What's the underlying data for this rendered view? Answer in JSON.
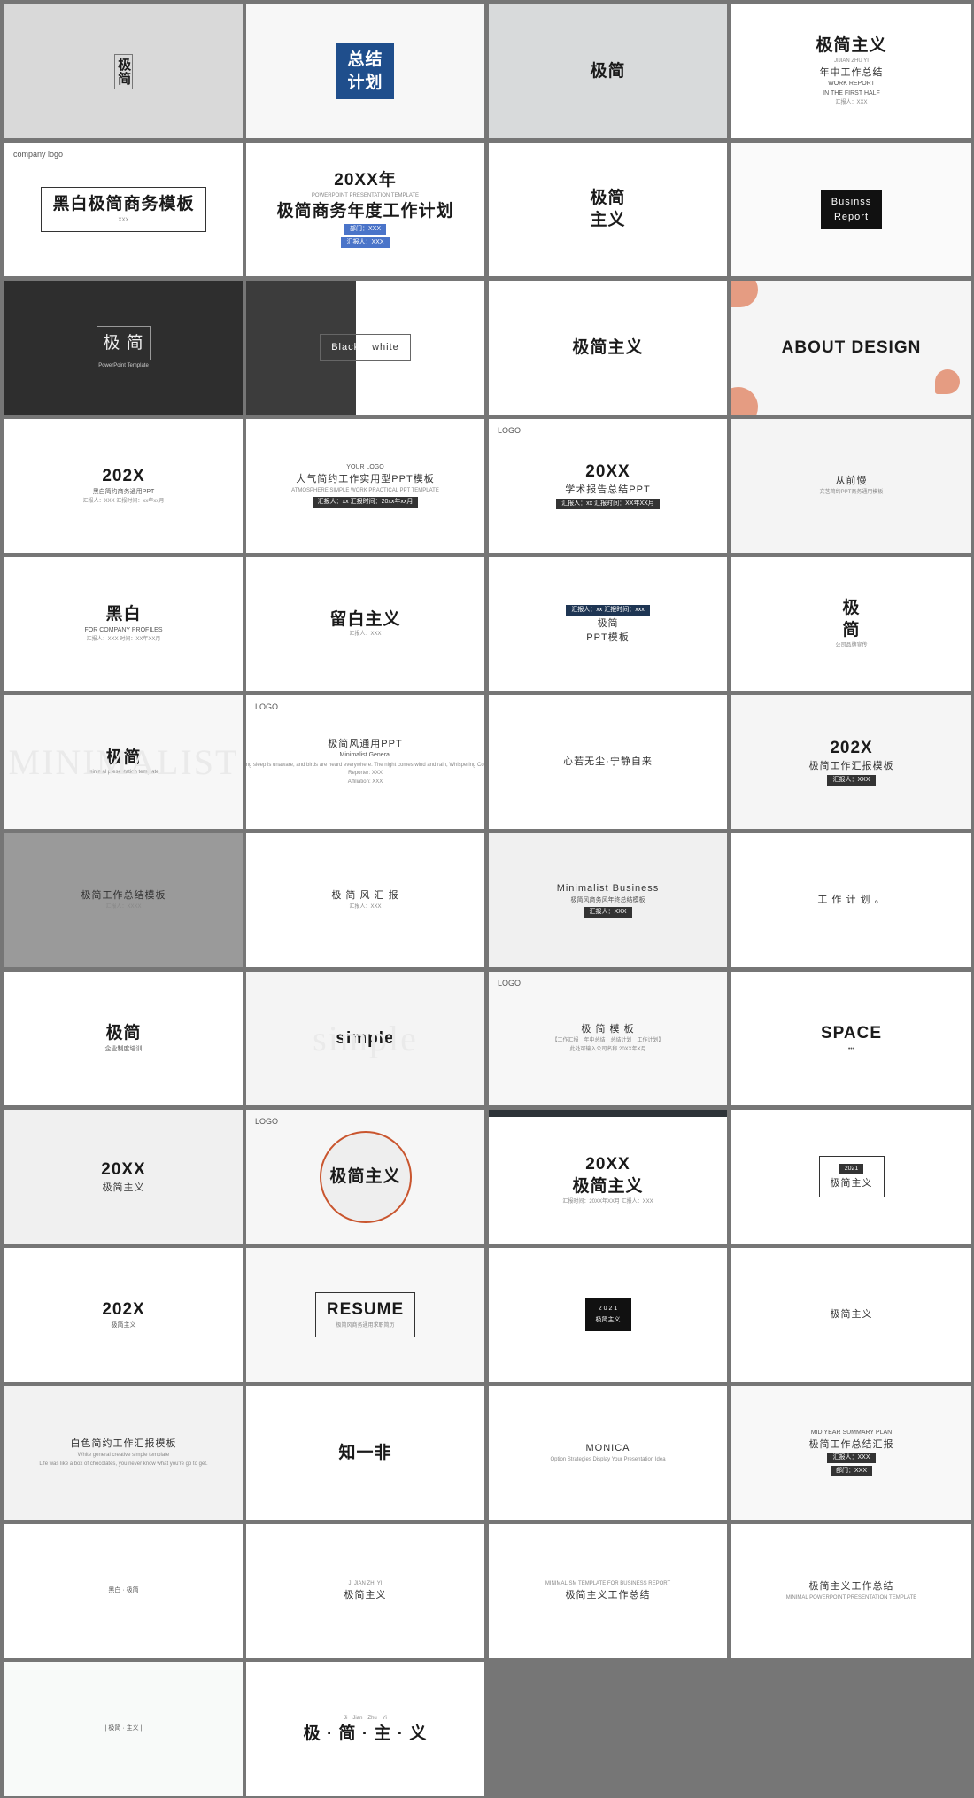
{
  "background_color": "#767676",
  "tiles": [
    {
      "bg": "#d9d9d9",
      "lines": [
        {
          "role": "title",
          "text": "极简"
        }
      ]
    },
    {
      "bg": "#f7f7f7",
      "accent": "#1f4e8c",
      "lines": [
        {
          "role": "title",
          "text": "总结"
        },
        {
          "role": "title",
          "text": "计划"
        }
      ]
    },
    {
      "bg": "#d8dadb",
      "lines": [
        {
          "role": "title",
          "text": "极简"
        }
      ]
    },
    {
      "bg": "#ffffff",
      "lines": [
        {
          "role": "title",
          "text": "极简主义"
        },
        {
          "role": "caption",
          "text": "JIJIAN ZHU YI"
        },
        {
          "role": "subtitle",
          "text": "年中工作总结"
        },
        {
          "role": "label",
          "text": "WORK REPORT"
        },
        {
          "role": "label",
          "text": "IN THE FIRST HALF"
        },
        {
          "role": "caption",
          "text": "汇报人：XXX"
        }
      ]
    },
    {
      "bg": "#ffffff",
      "lines": [
        {
          "role": "logo",
          "text": "company logo"
        },
        {
          "role": "title",
          "text": "黑白极简商务模板"
        },
        {
          "role": "caption",
          "text": "XXX"
        }
      ]
    },
    {
      "bg": "#ffffff",
      "accent": "#4a74c9",
      "lines": [
        {
          "role": "title",
          "text": "20XX年"
        },
        {
          "role": "caption",
          "text": "POWERPOINT PRESENTATION TEMPLATE"
        },
        {
          "role": "title",
          "text": "极简商务年度工作计划"
        },
        {
          "role": "badge",
          "text": "部门：XXX"
        },
        {
          "role": "badge",
          "text": "汇报人：XXX"
        }
      ]
    },
    {
      "bg": "#ffffff",
      "lines": [
        {
          "role": "title",
          "text": "极简"
        },
        {
          "role": "title",
          "text": "主义"
        }
      ]
    },
    {
      "bg": "#fafafa",
      "lines": [
        {
          "role": "subtitle",
          "text": "Businss"
        },
        {
          "role": "subtitle",
          "text": "Report"
        }
      ]
    },
    {
      "bg": "#2e2e2e",
      "lines": [
        {
          "role": "title",
          "text": "极 简"
        },
        {
          "role": "caption",
          "text": "PowerPoint Template"
        }
      ]
    },
    {
      "bg": "#ffffff",
      "lines": [
        {
          "role": "subtitle",
          "text": "Black"
        },
        {
          "role": "subtitle",
          "text": "white"
        }
      ]
    },
    {
      "bg": "#ffffff",
      "lines": [
        {
          "role": "title",
          "text": "极简主义"
        }
      ]
    },
    {
      "bg": "#f5f5f5",
      "accent": "#e59c82",
      "lines": [
        {
          "role": "title",
          "text": "ABOUT DESIGN"
        }
      ]
    },
    {
      "bg": "#ffffff",
      "lines": [
        {
          "role": "title",
          "text": "202X"
        },
        {
          "role": "label",
          "text": "黑白简约商务通用PPT"
        },
        {
          "role": "caption",
          "text": "汇报人：XXX 汇报时间：xx年xx月"
        }
      ]
    },
    {
      "bg": "#ffffff",
      "lines": [
        {
          "role": "label",
          "text": "YOUR LOGO"
        },
        {
          "role": "subtitle",
          "text": "大气简约工作实用型PPT模板"
        },
        {
          "role": "caption",
          "text": "ATMOSPHERE SIMPLE WORK PRACTICAL PPT TEMPLATE"
        },
        {
          "role": "badge",
          "text": "汇报人：xx 汇报时间：20xx年xx月"
        }
      ]
    },
    {
      "bg": "#ffffff",
      "lines": [
        {
          "role": "logo",
          "text": "LOGO"
        },
        {
          "role": "title",
          "text": "20XX"
        },
        {
          "role": "subtitle",
          "text": "学术报告总结PPT"
        },
        {
          "role": "badge",
          "text": "汇报人：xx 汇报时间：XX年XX月"
        }
      ]
    },
    {
      "bg": "#f4f4f4",
      "lines": [
        {
          "role": "subtitle",
          "text": "从前慢"
        },
        {
          "role": "caption",
          "text": "文艺简约PPT商务通用模板"
        }
      ]
    },
    {
      "bg": "#ffffff",
      "lines": [
        {
          "role": "title",
          "text": "黑白"
        },
        {
          "role": "label",
          "text": "FOR COMPANY PROFILES"
        },
        {
          "role": "caption",
          "text": "汇报人：XXX 时间：XX年XX月"
        }
      ]
    },
    {
      "bg": "#ffffff",
      "lines": [
        {
          "role": "title",
          "text": "留白主义"
        },
        {
          "role": "caption",
          "text": "汇报人：XXX"
        }
      ]
    },
    {
      "bg": "#ffffff",
      "accent": "#1e3553",
      "lines": [
        {
          "role": "badge",
          "text": "汇报人：xx 汇报时间：xxx"
        },
        {
          "role": "subtitle",
          "text": "极简"
        },
        {
          "role": "subtitle",
          "text": "PPT模板"
        }
      ]
    },
    {
      "bg": "#ffffff",
      "lines": [
        {
          "role": "title",
          "text": "极"
        },
        {
          "role": "title",
          "text": "简"
        },
        {
          "role": "caption",
          "text": "公司品牌宣传"
        }
      ]
    },
    {
      "bg": "#f7f7f7",
      "lines": [
        {
          "role": "watermark",
          "text": "MINIMALIST"
        },
        {
          "role": "title",
          "text": "极简"
        },
        {
          "role": "caption",
          "text": "minimal presentation template"
        }
      ]
    },
    {
      "bg": "#ffffff",
      "lines": [
        {
          "role": "logo",
          "text": "LOGO"
        },
        {
          "role": "subtitle",
          "text": "极简风通用PPT"
        },
        {
          "role": "label",
          "text": "Minimalist General"
        },
        {
          "role": "caption",
          "text": "Spring sleep is unaware, and birds are heard everywhere. The night comes wind and rain, Whispering Colour."
        },
        {
          "role": "caption",
          "text": "Reporter: XXX"
        },
        {
          "role": "caption",
          "text": "Affiliation: XXX"
        }
      ]
    },
    {
      "bg": "#ffffff",
      "accent": "#6a9a98",
      "lines": [
        {
          "role": "subtitle",
          "text": "心若无尘·宁静自来"
        }
      ]
    },
    {
      "bg": "#f5f5f5",
      "lines": [
        {
          "role": "title",
          "text": "202X"
        },
        {
          "role": "subtitle",
          "text": "极简工作汇报模板"
        },
        {
          "role": "badge",
          "text": "汇报人：XXX"
        }
      ]
    },
    {
      "bg": "#9a9a9a",
      "lines": [
        {
          "role": "subtitle",
          "text": "极简工作总结模板"
        },
        {
          "role": "caption",
          "text": "汇报人：XXXX"
        }
      ]
    },
    {
      "bg": "#ffffff",
      "lines": [
        {
          "role": "subtitle",
          "text": "极 简 风 汇 报"
        },
        {
          "role": "caption",
          "text": "汇报人：XXX"
        }
      ]
    },
    {
      "bg": "#f0f0f0",
      "lines": [
        {
          "role": "subtitle",
          "text": "Minimalist Business"
        },
        {
          "role": "label",
          "text": "极简风商务风年终总结模板"
        },
        {
          "role": "badge",
          "text": "汇报人：XXX"
        }
      ]
    },
    {
      "bg": "#ffffff",
      "lines": [
        {
          "role": "subtitle",
          "text": "工 作 计 划 。"
        }
      ]
    },
    {
      "bg": "#ffffff",
      "accent": "#3a3d4a",
      "lines": [
        {
          "role": "title",
          "text": "极简"
        },
        {
          "role": "label",
          "text": "企业制度培训"
        }
      ]
    },
    {
      "bg": "#f4f4f4",
      "lines": [
        {
          "role": "watermark",
          "text": "simple"
        },
        {
          "role": "title",
          "text": "simple"
        }
      ]
    },
    {
      "bg": "#f7f7f7",
      "lines": [
        {
          "role": "logo",
          "text": "LOGO"
        },
        {
          "role": "subtitle",
          "text": "极 简 模 板"
        },
        {
          "role": "caption",
          "text": "【工作汇报　年中总结　总结计划　工作计划】"
        },
        {
          "role": "caption",
          "text": "此处可输入公司名称 20XX年X月"
        }
      ]
    },
    {
      "bg": "#ffffff",
      "lines": [
        {
          "role": "title",
          "text": "SPACE"
        },
        {
          "role": "label",
          "text": "•••"
        }
      ]
    },
    {
      "bg": "#f0f0f0",
      "lines": [
        {
          "role": "title",
          "text": "20XX"
        },
        {
          "role": "subtitle",
          "text": "极简主义"
        }
      ]
    },
    {
      "bg": "#f6f6f6",
      "accent": "#c9552e",
      "lines": [
        {
          "role": "logo",
          "text": "LOGO"
        },
        {
          "role": "title",
          "text": "极简主义"
        }
      ]
    },
    {
      "bg": "#ffffff",
      "lines": [
        {
          "role": "title",
          "text": "20XX"
        },
        {
          "role": "title",
          "text": "极简主义"
        },
        {
          "role": "caption",
          "text": "汇报时间：20XX年XX月 汇报人：XXX"
        }
      ]
    },
    {
      "bg": "#ffffff",
      "lines": [
        {
          "role": "badge",
          "text": "2021"
        },
        {
          "role": "subtitle",
          "text": "极简主义"
        }
      ]
    },
    {
      "bg": "#ffffff",
      "lines": [
        {
          "role": "title",
          "text": "202X"
        },
        {
          "role": "label",
          "text": "极简主义"
        }
      ]
    },
    {
      "bg": "#f7f7f7",
      "lines": [
        {
          "role": "title",
          "text": "RESUME"
        },
        {
          "role": "caption",
          "text": "极简风商务通用求职简历"
        }
      ]
    },
    {
      "bg": "#ffffff",
      "lines": [
        {
          "role": "label",
          "text": "2 0 2 1"
        },
        {
          "role": "label",
          "text": "极简主义"
        }
      ]
    },
    {
      "bg": "#ffffff",
      "lines": [
        {
          "role": "subtitle",
          "text": "极简主义"
        }
      ]
    },
    {
      "bg": "#f2f2f2",
      "lines": [
        {
          "role": "subtitle",
          "text": "白色简约工作汇报模板"
        },
        {
          "role": "caption",
          "text": "White general creative simple template"
        },
        {
          "role": "caption",
          "text": "Life was like a box of chocolates, you never know what you're go to get."
        }
      ]
    },
    {
      "bg": "#ffffff",
      "lines": [
        {
          "role": "title",
          "text": "知一非"
        }
      ]
    },
    {
      "bg": "#ffffff",
      "accent": "#2a7bbd",
      "lines": [
        {
          "role": "subtitle",
          "text": "MONICA"
        },
        {
          "role": "caption",
          "text": "Option Strategies Display Your Presentation Idea"
        }
      ]
    },
    {
      "bg": "#f8f8f8",
      "lines": [
        {
          "role": "label",
          "text": "MID YEAR SUMMARY PLAN"
        },
        {
          "role": "subtitle",
          "text": "极简工作总结汇报"
        },
        {
          "role": "badge",
          "text": "汇报人：XXX"
        },
        {
          "role": "badge",
          "text": "部门：XXX"
        }
      ]
    },
    {
      "bg": "#ffffff",
      "lines": [
        {
          "role": "label",
          "text": "黑白 · 极简"
        }
      ]
    },
    {
      "bg": "#ffffff",
      "lines": [
        {
          "role": "caption",
          "text": "JI JIAN ZHI YI"
        },
        {
          "role": "subtitle",
          "text": "极简主义"
        }
      ]
    },
    {
      "bg": "#ffffff",
      "accent": "#e6eef0",
      "lines": [
        {
          "role": "caption",
          "text": "MINIMALISM TEMPLATE FOR BUSINESS REPORT"
        },
        {
          "role": "subtitle",
          "text": "极简主义工作总结"
        }
      ]
    },
    {
      "bg": "#ffffff",
      "lines": [
        {
          "role": "subtitle",
          "text": "极简主义工作总结"
        },
        {
          "role": "caption",
          "text": "MINIMAL POWERPOINT PRESENTATION TEMPLATE"
        }
      ]
    },
    {
      "bg": "#f8faf9",
      "lines": [
        {
          "role": "label",
          "text": "| 极简 · 主义 |"
        }
      ]
    },
    {
      "bg": "#ffffff",
      "lines": [
        {
          "role": "caption",
          "text": "Ji　Jian　Zhu　Yi"
        },
        {
          "role": "title",
          "text": "极 · 简 · 主 · 义"
        }
      ]
    }
  ]
}
